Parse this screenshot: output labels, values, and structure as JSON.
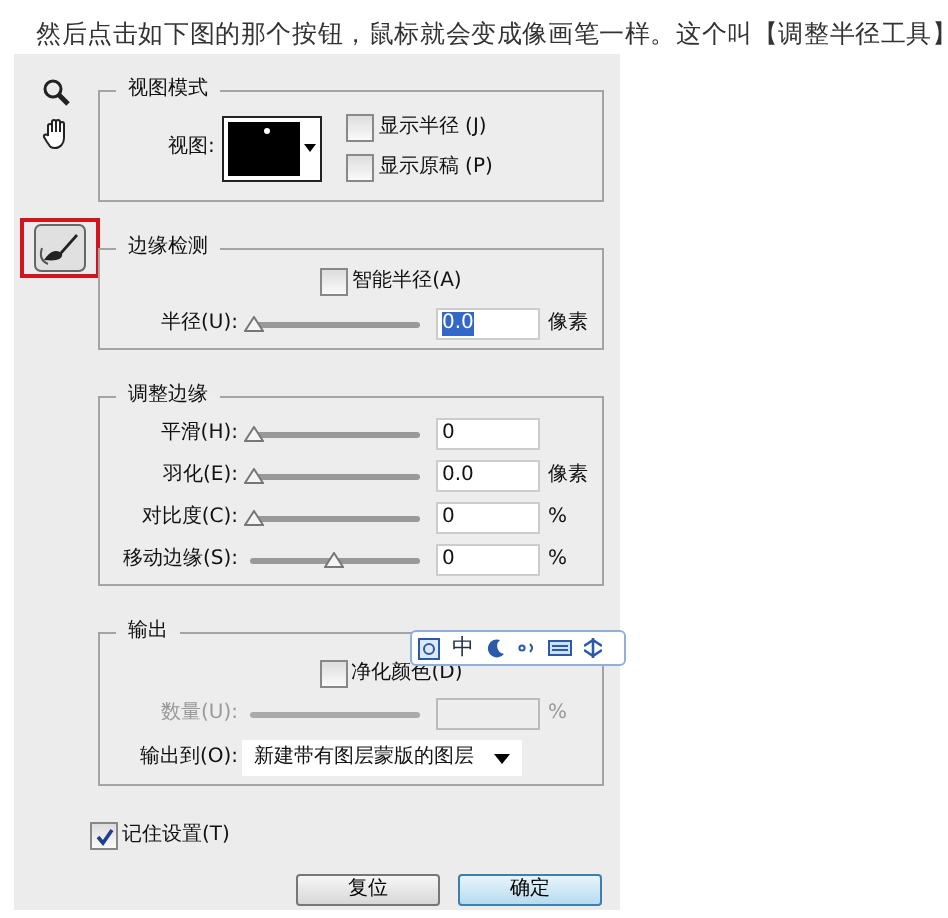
{
  "caption": "然后点击如下图的那个按钮，鼠标就会变成像画笔一样。这个叫【调整半径工具】",
  "tools": [
    {
      "kind": "zoom",
      "annotated": false
    },
    {
      "kind": "hand",
      "annotated": false
    },
    {
      "kind": "refine-brush",
      "annotated": true
    }
  ],
  "view_mode": {
    "title": "视图模式",
    "view_label": "视图:",
    "checkboxes": [
      {
        "label": "显示半径 (J)",
        "checked": false
      },
      {
        "label": "显示原稿 (P)",
        "checked": false
      }
    ]
  },
  "edge_detection": {
    "title": "边缘检测",
    "smart_radius": {
      "label": "智能半径(A)",
      "checked": false
    },
    "rows": [
      {
        "label": "半径(U):",
        "level": 0,
        "value": "0.0",
        "value_selected": true,
        "unit": "像素"
      }
    ]
  },
  "adjust_edge": {
    "title": "调整边缘",
    "rows": [
      {
        "label": "平滑(H):",
        "level": 0,
        "value": "0",
        "value_selected": false
      },
      {
        "label": "羽化(E):",
        "level": 0,
        "value": "0.0",
        "value_selected": false,
        "unit": "像素"
      },
      {
        "label": "对比度(C):",
        "level": 0,
        "value": "0",
        "value_selected": false,
        "unit": "%"
      },
      {
        "label": "移动边缘(S):",
        "level": 0.5,
        "value": "0",
        "value_selected": false,
        "unit": "%"
      }
    ]
  },
  "output": {
    "title": "输出",
    "decontaminate": {
      "label": "净化颜色(D)",
      "checked": false
    },
    "amount": {
      "label": "数量(U):",
      "disabled": true,
      "unit": "%"
    },
    "output_to": {
      "label": "输出到(O):",
      "value": "新建带有图层蒙版的图层"
    }
  },
  "ime_bar": {
    "mode": "中"
  },
  "remember": {
    "label": "记住设置(T)",
    "checked": true
  },
  "buttons": [
    {
      "label": "复位",
      "default": false
    },
    {
      "label": "确定",
      "default": true
    }
  ]
}
